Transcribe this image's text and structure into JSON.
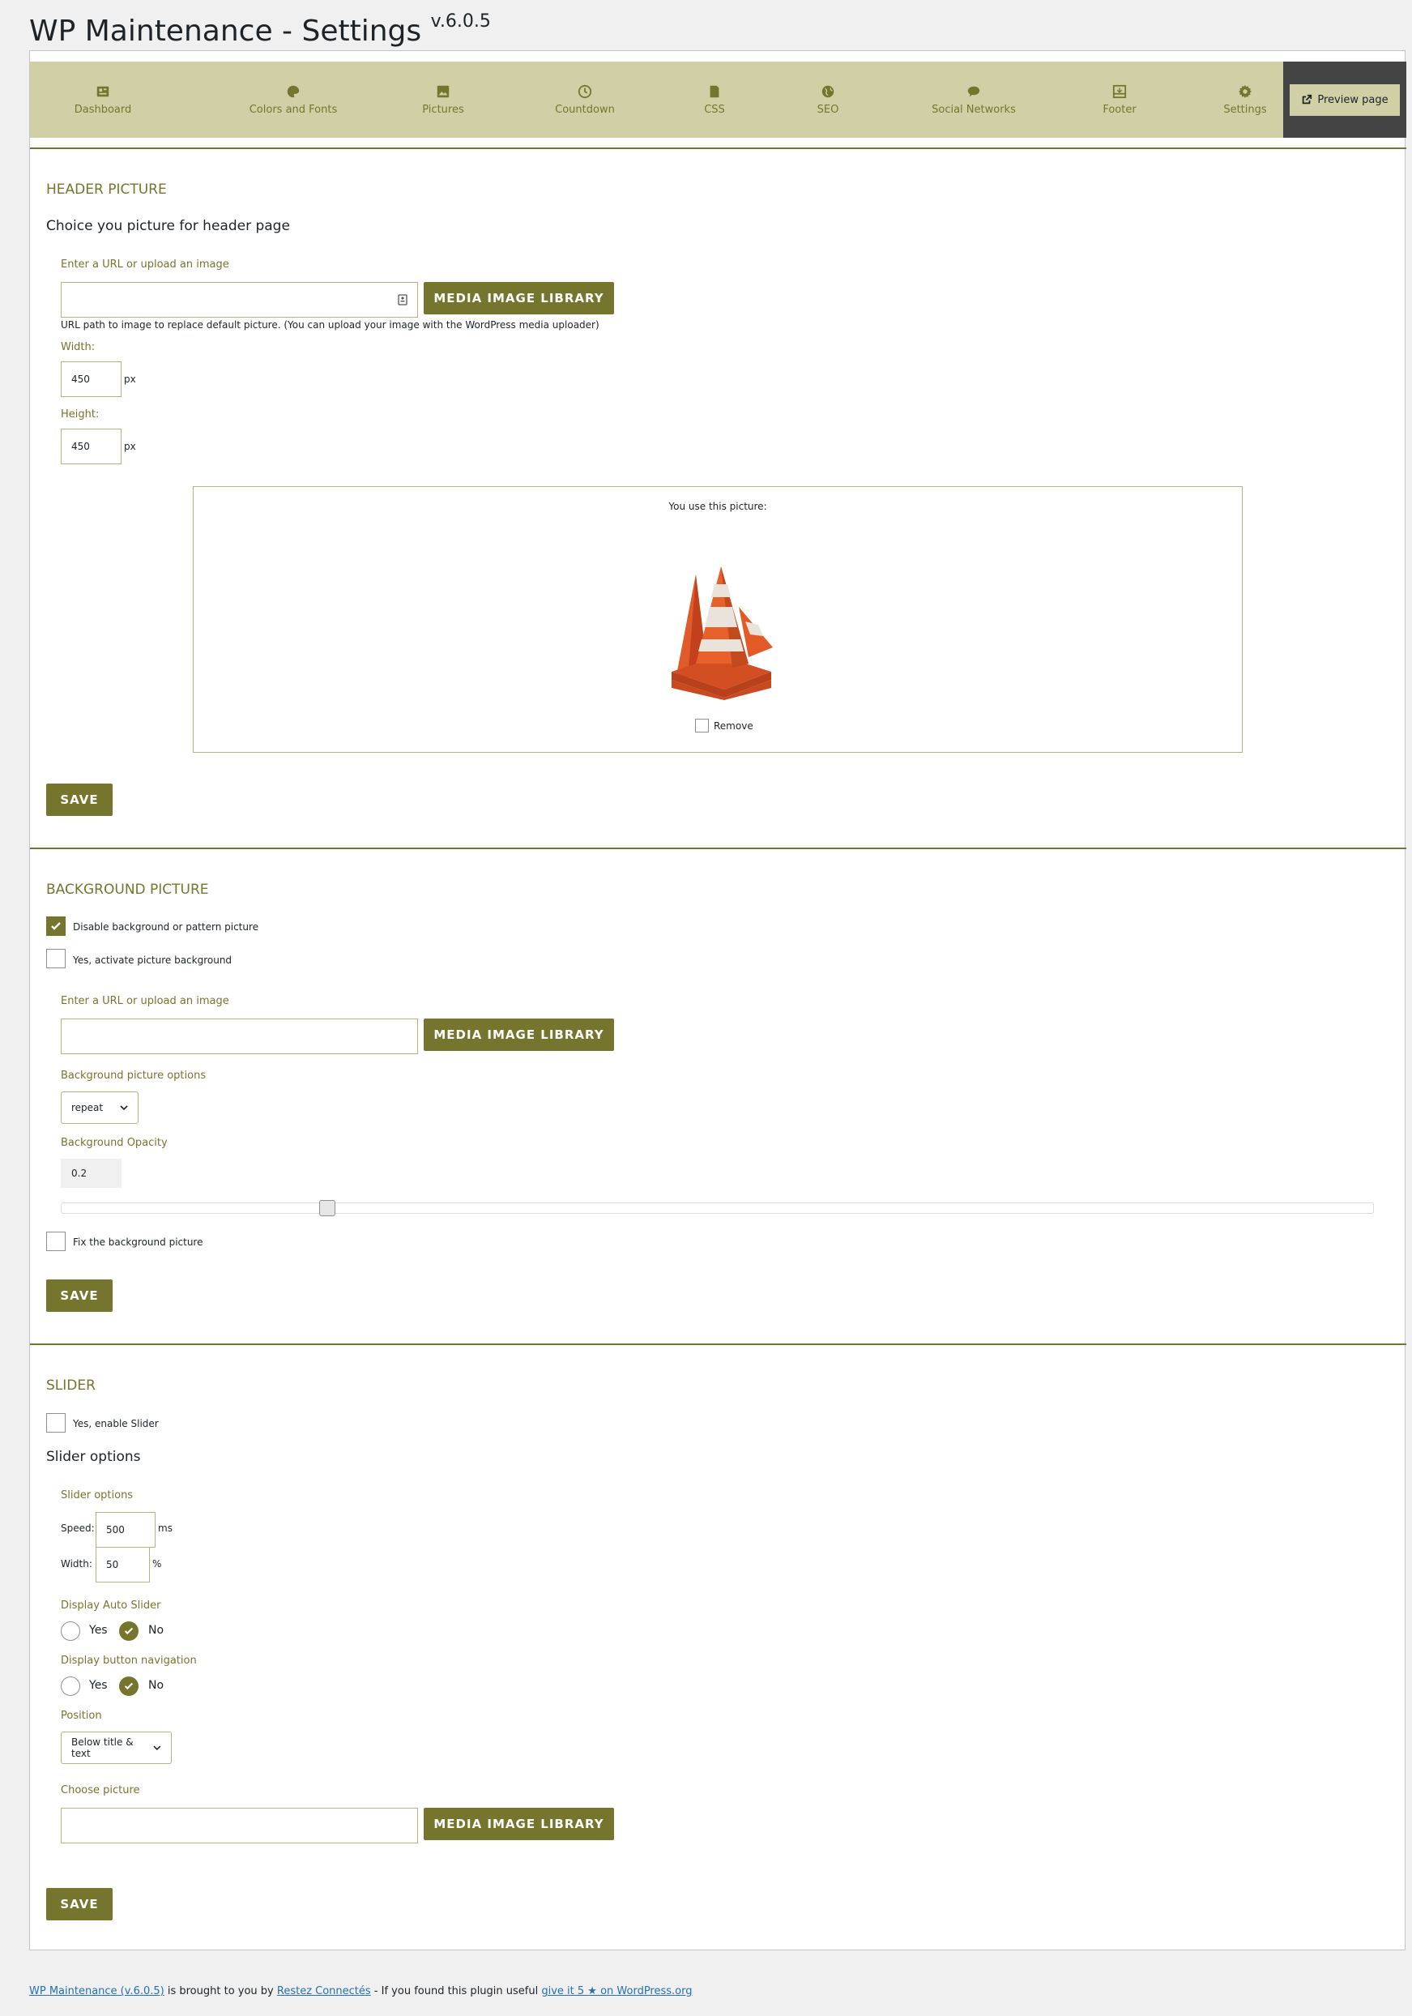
{
  "page": {
    "title": "WP Maintenance - Settings",
    "version": "v.6.0.5"
  },
  "nav": {
    "items": [
      {
        "label": "Dashboard",
        "icon": "dashboard-icon"
      },
      {
        "label": "Colors and Fonts",
        "icon": "palette-icon"
      },
      {
        "label": "Pictures",
        "icon": "pictures-icon"
      },
      {
        "label": "Countdown",
        "icon": "clock-icon"
      },
      {
        "label": "CSS",
        "icon": "css-icon"
      },
      {
        "label": "SEO",
        "icon": "globe-icon"
      },
      {
        "label": "Social Networks",
        "icon": "chat-icon"
      },
      {
        "label": "Footer",
        "icon": "footer-icon"
      },
      {
        "label": "Settings",
        "icon": "gear-icon"
      }
    ],
    "preview_label": "Preview page"
  },
  "header_picture": {
    "title": "HEADER PICTURE",
    "subtitle": "Choice you picture for header page",
    "url_label": "Enter a URL or upload an image",
    "url_value": "",
    "media_button": "MEDIA IMAGE LIBRARY",
    "help": "URL path to image to replace default picture. (You can upload your image with the WordPress media uploader)",
    "width_label": "Width:",
    "width_value": "450",
    "width_unit": "px",
    "height_label": "Height:",
    "height_value": "450",
    "height_unit": "px",
    "preview_caption": "You use this picture:",
    "remove_label": "Remove",
    "remove_checked": false,
    "save": "SAVE"
  },
  "background_picture": {
    "title": "BACKGROUND PICTURE",
    "disable_label": "Disable background or pattern picture",
    "disable_checked": true,
    "activate_label": "Yes, activate picture background",
    "activate_checked": false,
    "url_label": "Enter a URL or upload an image",
    "url_value": "",
    "media_button": "MEDIA IMAGE LIBRARY",
    "options_label": "Background picture options",
    "options_value": "repeat",
    "opacity_label": "Background Opacity",
    "opacity_value": "0.2",
    "opacity_slider_fraction": 0.2,
    "fix_label": "Fix the background picture",
    "fix_checked": false,
    "save": "SAVE"
  },
  "slider": {
    "title": "SLIDER",
    "enable_label": "Yes, enable Slider",
    "enable_checked": false,
    "options_title": "Slider options",
    "options_label": "Slider options",
    "speed_label": "Speed:",
    "speed_value": "500",
    "speed_unit": "ms",
    "width_label": "Width:",
    "width_value": "50",
    "width_unit": "%",
    "auto_label": "Display Auto Slider",
    "auto_yes": "Yes",
    "auto_no": "No",
    "auto_selected": "No",
    "nav_label": "Display button navigation",
    "nav_yes": "Yes",
    "nav_no": "No",
    "nav_selected": "No",
    "position_label": "Position",
    "position_value": "Below title & text",
    "choose_label": "Choose picture",
    "choose_value": "",
    "media_button": "MEDIA IMAGE LIBRARY",
    "save": "SAVE"
  },
  "footer": {
    "plugin_link": "WP Maintenance (v.6.0.5)",
    "text1": " is brought to you by ",
    "author_link": "Restez Connectés",
    "text2": " - If you found this plugin useful ",
    "rate_link": "give it 5 ★ on WordPress.org"
  },
  "colors": {
    "accent": "#76752e",
    "nav_bg": "#d1cfa6",
    "preview_bg": "#444444"
  }
}
